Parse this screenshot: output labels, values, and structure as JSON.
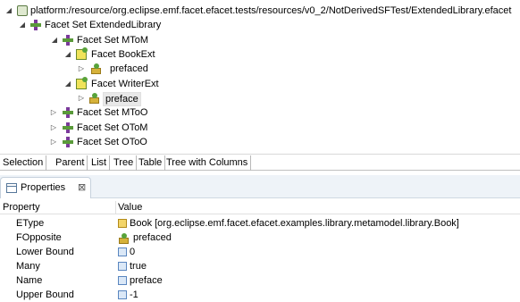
{
  "tree": {
    "root": "platform:/resource/org.eclipse.emf.facet.efacet.tests/resources/v0_2/NotDerivedSFTest/ExtendedLibrary.efacet",
    "facet_set_extended": "Facet Set ExtendedLibrary",
    "facet_set_mtom": "Facet Set MToM",
    "facet_bookext": "Facet BookExt",
    "prefaced": "prefaced",
    "facet_writerext": "Facet WriterExt",
    "preface": "preface",
    "facet_set_mtoo": "Facet Set MToO",
    "facet_set_otom": "Facet Set OToM",
    "facet_set_otoo": "Facet Set OToO"
  },
  "tabs": [
    "Selection",
    "Parent",
    "List",
    "Tree",
    "Table",
    "Tree with Columns"
  ],
  "properties_view": {
    "title": "Properties",
    "close_glyph": "⊠",
    "col_property": "Property",
    "col_value": "Value",
    "rows": [
      {
        "property": "EType",
        "value": "Book [org.eclipse.emf.facet.efacet.examples.library.metamodel.library.Book]"
      },
      {
        "property": "FOpposite",
        "value": "prefaced"
      },
      {
        "property": "Lower Bound",
        "value": "0"
      },
      {
        "property": "Many",
        "value": "true"
      },
      {
        "property": "Name",
        "value": "preface"
      },
      {
        "property": "Upper Bound",
        "value": "-1"
      }
    ]
  },
  "icons": {
    "root": "efacet-file-icon",
    "facet_set": "facet-set-icon",
    "facet": "facet-icon",
    "reference": "facet-reference-icon",
    "etype": "eclass-icon",
    "literal": "literal-value-icon"
  }
}
